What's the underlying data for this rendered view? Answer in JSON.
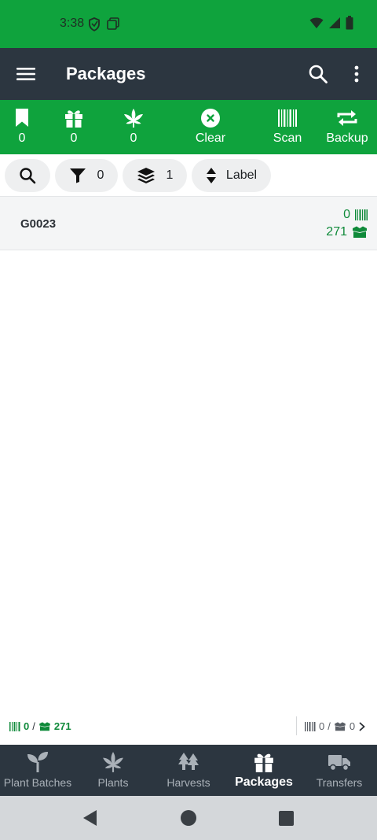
{
  "status_bar": {
    "time": "3:38"
  },
  "app_bar": {
    "title": "Packages"
  },
  "toolbar": {
    "bookmark_count": "0",
    "gift_count": "0",
    "leaf_count": "0",
    "clear_label": "Clear",
    "scan_label": "Scan",
    "backup_label": "Backup"
  },
  "chips": {
    "filter_count": "0",
    "layers_count": "1",
    "sort_label": "Label"
  },
  "packages": [
    {
      "label": "G0023",
      "scanned_count": "0",
      "quantity": "271"
    }
  ],
  "summary": {
    "left_scanned": "0",
    "left_sep": "/",
    "left_total": "271",
    "right_scanned": "0",
    "right_sep": "/",
    "right_total": "0"
  },
  "bottom_nav": {
    "items": [
      {
        "label": "Plant Batches"
      },
      {
        "label": "Plants"
      },
      {
        "label": "Harvests"
      },
      {
        "label": "Packages"
      },
      {
        "label": "Transfers"
      }
    ],
    "active": "Packages"
  },
  "colors": {
    "accent_green": "#0fa33d",
    "dark_bar": "#2c3640",
    "count_green": "#0f8a3a"
  },
  "icons": [
    "menu-icon",
    "search-icon",
    "more-vert-icon",
    "bookmark-icon",
    "gift-icon",
    "leaf-icon",
    "clear-circle-icon",
    "barcode-icon",
    "sync-icon",
    "filter-icon",
    "layers-icon",
    "sort-icon",
    "box-icon",
    "sprout-icon",
    "trees-icon",
    "truck-icon",
    "back-triangle-icon",
    "home-circle-icon",
    "recents-square-icon"
  ]
}
